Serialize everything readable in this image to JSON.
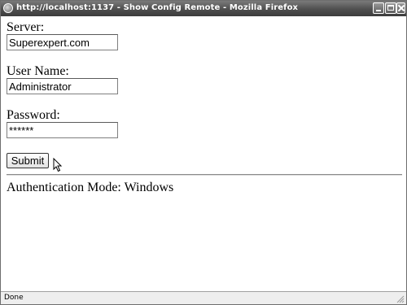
{
  "window": {
    "title": "http://localhost:1137 - Show Config Remote - Mozilla Firefox",
    "icon": "firefox-icon",
    "controls": [
      "minimize-icon",
      "maximize-icon",
      "close-icon"
    ]
  },
  "form": {
    "server": {
      "label": "Server:",
      "value": "Superexpert.com"
    },
    "username": {
      "label": "User Name:",
      "value": "Administrator"
    },
    "password": {
      "label": "Password:",
      "value": "******"
    },
    "submit_label": "Submit"
  },
  "result": {
    "auth_mode_text": "Authentication Mode: Windows"
  },
  "statusbar": {
    "text": "Done"
  }
}
